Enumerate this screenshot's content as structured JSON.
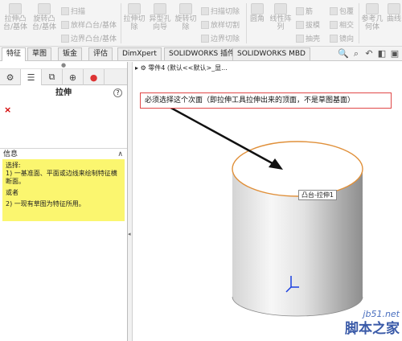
{
  "ribbon": {
    "extrude_boss": "拉伸凸\n台/基体",
    "revolve_boss": "旋转凸\n台/基体",
    "sweep": "扫描",
    "loft_boss": "放样凸台/基体",
    "boundary_boss": "边界凸台/基体",
    "extrude_cut": "拉伸切\n除",
    "hole_wizard": "异型孔\n向导",
    "revolve_cut": "旋转切\n除",
    "swept_cut": "扫描切除",
    "lofted_cut": "放样切割",
    "boundary_cut": "边界切除",
    "fillet": "圆角",
    "linear_pattern": "线性阵\n列",
    "rib": "筋",
    "draft": "拔模",
    "shell": "抽壳",
    "wrap": "包覆",
    "intersect": "相交",
    "mirror": "镜向",
    "ref_geometry": "参考几\n何体",
    "curves": "曲线"
  },
  "tabs": [
    "特征",
    "草图",
    "钣金",
    "评估",
    "DimXpert",
    "SOLIDWORKS 插件",
    "SOLIDWORKS MBD"
  ],
  "panel": {
    "title": "拉伸",
    "help": "?",
    "error_mark": "×",
    "info_header": "信息",
    "info_lines": [
      "选择:",
      "1) 一基准面、平面或边线来绘制特征横断面。",
      "或者",
      "2) 一现有草图为特征所用。"
    ]
  },
  "view": {
    "tree_label": "零件4 (默认<<默认>_显...",
    "annotation": "必须选择这个次面（即拉伸工具拉伸出来的顶面，不是草图基面）",
    "tooltip": "凸台-拉伸1"
  },
  "watermark": {
    "line1": "jb51.net",
    "line2": "脚本之家"
  },
  "colors": {
    "annotation_border": "#e04848",
    "info_bg": "#fbf66f",
    "edge_highlight": "#e0903a"
  }
}
